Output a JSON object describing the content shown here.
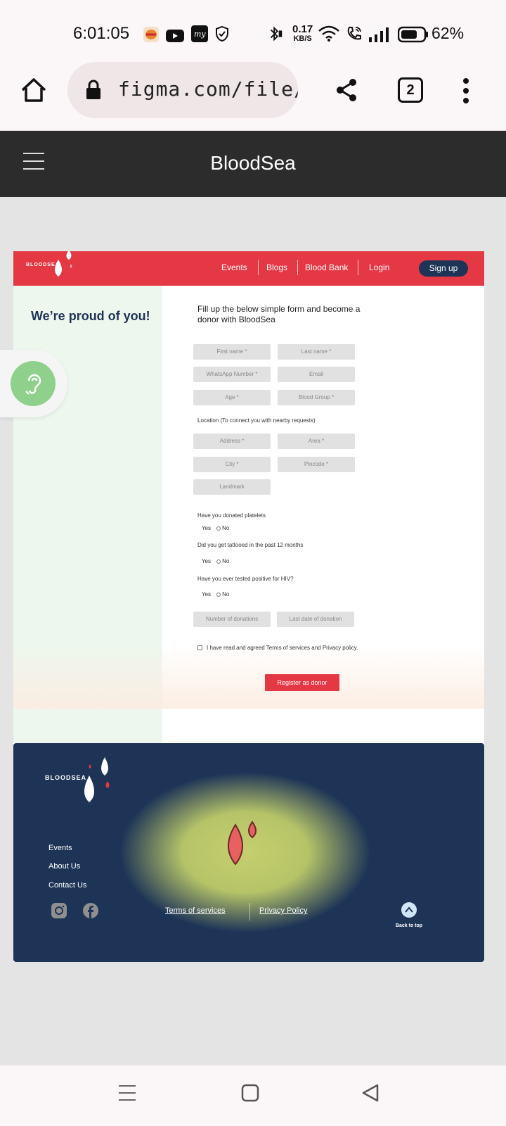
{
  "status_bar": {
    "time": "6:01:05",
    "net_speed_value": "0.17",
    "net_speed_unit": "KB/S",
    "battery": "62%",
    "icons": [
      "burger-king-app-icon",
      "youtube-icon",
      "myntra-icon",
      "shield-icon",
      "bluetooth-icon",
      "wifi-icon",
      "wifi-calling-icon",
      "signal-icon",
      "battery-icon"
    ]
  },
  "browser": {
    "url": "figma.com/file/Bq",
    "tab_count": "2"
  },
  "app_header": {
    "title": "BloodSea"
  },
  "site_nav": {
    "logo": "BLOODSEA",
    "links": [
      "Events",
      "Blogs",
      "Blood Bank",
      "Login"
    ],
    "signup": "Sign up",
    "colors": {
      "primary": "#e53845",
      "navy": "#1e3457"
    }
  },
  "hero": {
    "proud_text": "We’re proud of you!"
  },
  "form": {
    "title": "Fill up the below simple form and become a donor with BloodSea",
    "fields": {
      "first_name": "First name *",
      "last_name": "Last name *",
      "whatsapp": "WhatsApp Number *",
      "email": "Email",
      "age": "Age *",
      "blood_group": "Blood Group *",
      "address": "Address *",
      "area": "Area *",
      "city": "City *",
      "pincode": "Pincode *",
      "landmark": "Landmark",
      "donations": "Number of donations",
      "last_date": "Last date of donation"
    },
    "location_label": "Location (To connect you with nearby requests)",
    "q1": "Have you donated platelets",
    "q2": "Did you get tattooed in the past 12 months",
    "q3": "Have you ever tested positive for HIV?",
    "yes": "Yes",
    "no": "No",
    "terms": "I have read and agreed Terms of services and Privacy policy.",
    "register": "Register as donor"
  },
  "footer": {
    "logo": "BLOODSEA",
    "links": [
      "Events",
      "About Us",
      "Contact Us"
    ],
    "terms": "Terms of services",
    "privacy": "Privacy Policy",
    "back_to_top": "Back to top",
    "social": [
      "instagram-icon",
      "facebook-icon"
    ]
  }
}
